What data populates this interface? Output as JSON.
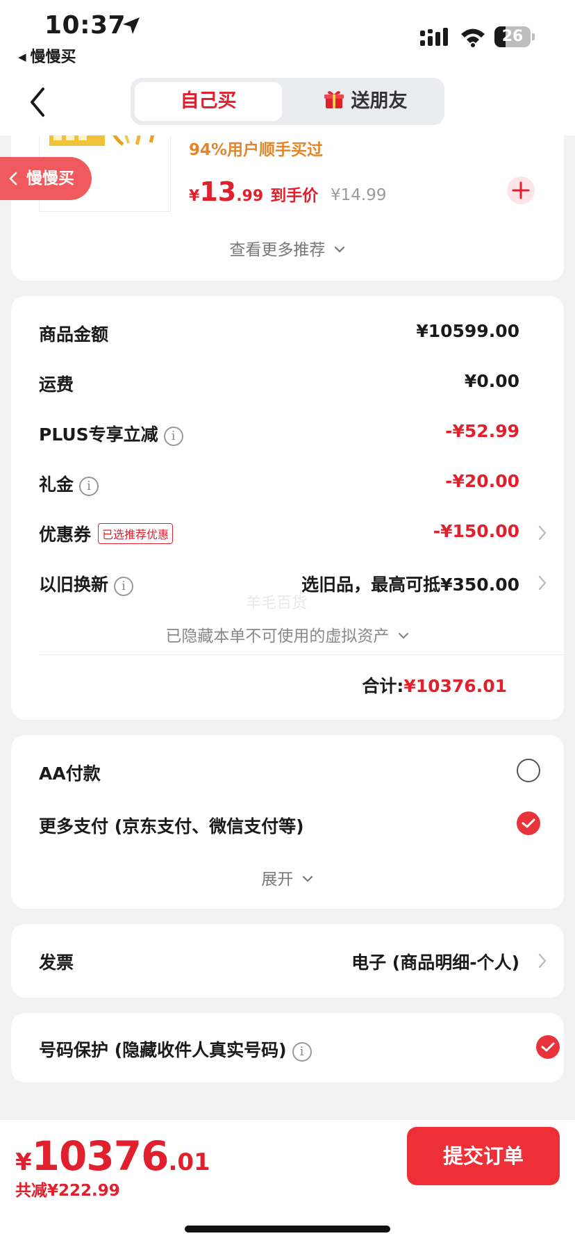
{
  "status_bar": {
    "time": "10:37",
    "back_app": "慢慢买",
    "battery": "26"
  },
  "header": {
    "tabs": [
      {
        "label": "自己买",
        "active": true
      },
      {
        "label": "送朋友",
        "active": false,
        "icon": "gift-icon"
      }
    ]
  },
  "recommendation": {
    "subtitle": "94%用户顺手买过",
    "price_currency": "¥",
    "price_integer": "13",
    "price_decimal": ".99",
    "price_tag": "到手价",
    "original_price": "¥14.99",
    "more_label": "查看更多推荐"
  },
  "floating_tag": "慢慢买",
  "summary": {
    "rows": [
      {
        "label": "商品金额",
        "value": "¥10599.00"
      },
      {
        "label": "运费",
        "value": "¥0.00"
      },
      {
        "label": "PLUS专享立减",
        "value": "-¥52.99"
      },
      {
        "label": "礼金",
        "value": "-¥20.00"
      },
      {
        "label": "优惠券",
        "badge": "已选推荐优惠",
        "value": "-¥150.00"
      },
      {
        "label": "以旧换新",
        "value": "选旧品，最高可抵¥350.00"
      }
    ],
    "watermark": "羊毛百货",
    "hidden_note": "已隐藏本单不可使用的虚拟资产",
    "total_label": "合计:",
    "total_value": "¥10376.01"
  },
  "payment": {
    "options": [
      {
        "label": "AA付款",
        "selected": false
      },
      {
        "label": "更多支付 (京东支付、微信支付等)",
        "selected": true
      }
    ],
    "expand_label": "展开"
  },
  "invoice": {
    "label": "发票",
    "value": "电子 (商品明细-个人)"
  },
  "phone_protect": {
    "label": "号码保护 (隐藏收件人真实号码)",
    "enabled": true
  },
  "bottom": {
    "price_currency": "¥",
    "price_integer": "10376",
    "price_decimal": ".01",
    "saving": "共减¥222.99",
    "submit": "提交订单"
  },
  "colors": {
    "accent_red": "#e0202d",
    "orange": "#e3852a",
    "background": "#f2f2f2"
  }
}
